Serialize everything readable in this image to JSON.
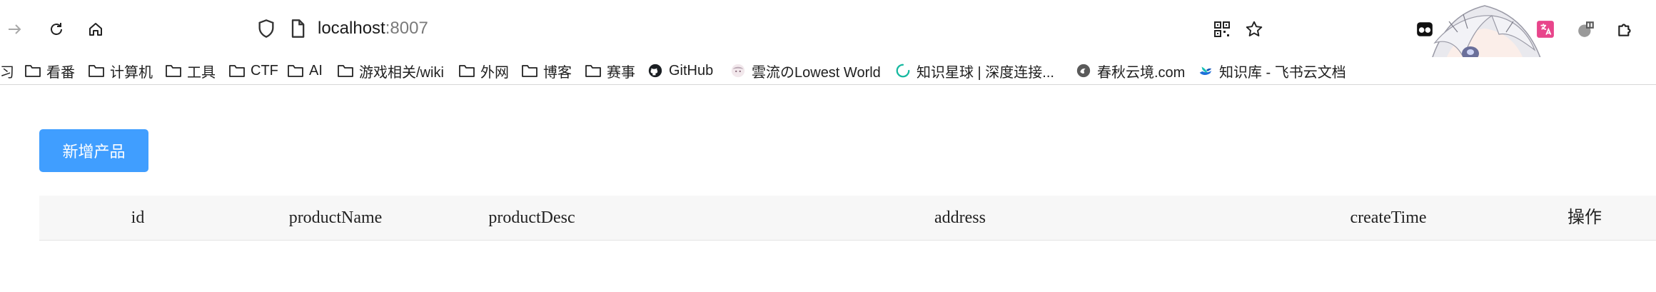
{
  "browser": {
    "url": {
      "host": "localhost",
      "port": ":8007"
    }
  },
  "bookmarks": [
    {
      "icon": "folder-icon",
      "label": "习"
    },
    {
      "icon": "folder-icon",
      "label": "看番"
    },
    {
      "icon": "folder-icon",
      "label": "计算机"
    },
    {
      "icon": "folder-icon",
      "label": "工具"
    },
    {
      "icon": "folder-icon",
      "label": "CTF"
    },
    {
      "icon": "folder-icon",
      "label": "AI"
    },
    {
      "icon": "folder-icon",
      "label": "游戏相关/wiki"
    },
    {
      "icon": "folder-icon",
      "label": "外网"
    },
    {
      "icon": "folder-icon",
      "label": "博客"
    },
    {
      "icon": "folder-icon",
      "label": "赛事"
    },
    {
      "icon": "github-icon",
      "label": "GitHub"
    },
    {
      "icon": "anime-avatar-icon",
      "label": "雲流のLowest World"
    },
    {
      "icon": "loading-ring-icon",
      "label": "知识星球 | 深度连接..."
    },
    {
      "icon": "cloud-logo-icon",
      "label": "春秋云境.com"
    },
    {
      "icon": "feishu-icon",
      "label": "知识库 - 飞书云文档"
    }
  ],
  "page": {
    "add_button_label": "新增产品",
    "table": {
      "columns": [
        "id",
        "productName",
        "productDesc",
        "address",
        "createTime",
        "操作"
      ]
    }
  },
  "colors": {
    "primary": "#409eff",
    "header_bg": "#f7f7f7"
  }
}
